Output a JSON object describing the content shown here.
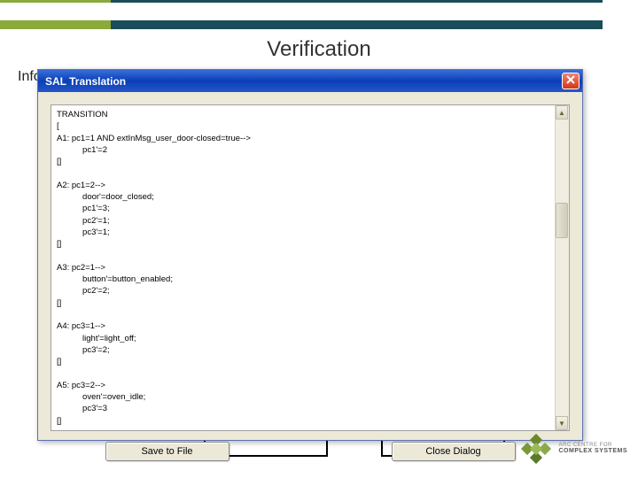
{
  "header": {
    "title": "Verification"
  },
  "page": {
    "info_label": "Info"
  },
  "dialog": {
    "title": "SAL Translation",
    "content": "TRANSITION\n[\nA1: pc1=1 AND extInMsg_user_door-closed=true-->\n           pc1'=2\n[]\n\nA2: pc1=2-->\n           door'=door_closed;\n           pc1'=3;\n           pc2'=1;\n           pc3'=1;\n[]\n\nA3: pc2=1-->\n           button'=button_enabled;\n           pc2'=2;\n[]\n\nA4: pc3=1-->\n           light'=light_off;\n           pc3'=2;\n[]\n\nA5: pc3=2-->\n           oven'=oven_idle;\n           pc3'=3\n[]",
    "buttons": {
      "save": "Save to File",
      "close": "Close Dialog"
    }
  },
  "logo": {
    "line1": "ARC CENTRE FOR",
    "line2": "COMPLEX SYSTEMS"
  }
}
